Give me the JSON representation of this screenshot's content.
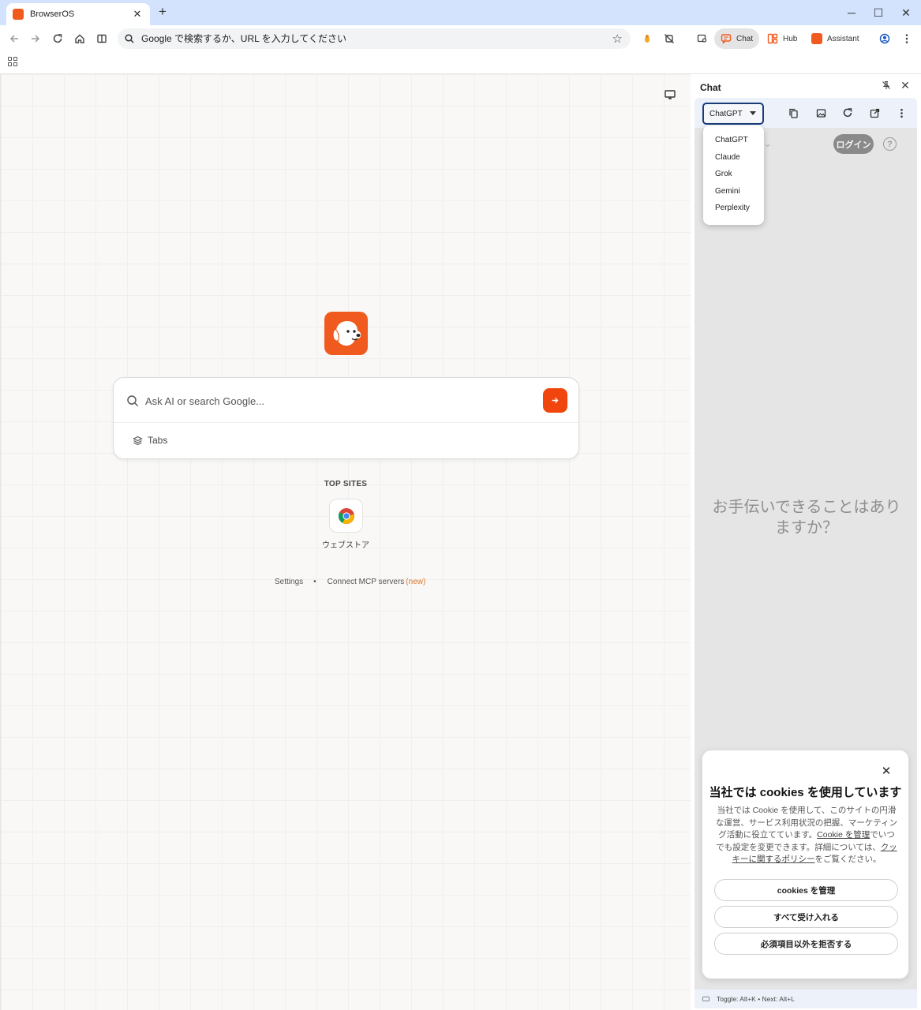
{
  "window": {
    "tab_title": "BrowserOS",
    "tab_close": "✕",
    "new_tab": "+",
    "minimize": "─",
    "maximize": "☐",
    "close": "✕"
  },
  "toolbar": {
    "omnibox_placeholder": "Google で検索するか、URL を入力してください",
    "chat_label": "Chat",
    "hub_label": "Hub",
    "assistant_label": "Assistant"
  },
  "main": {
    "search_placeholder": "Ask AI or search Google...",
    "tabs_label": "Tabs",
    "top_sites_label": "TOP SITES",
    "top_sites": [
      {
        "label": "ウェブストア"
      }
    ],
    "footer": {
      "settings": "Settings",
      "separator": "•",
      "connect_mcp": "Connect MCP servers",
      "new_badge": "(new)"
    }
  },
  "side_panel": {
    "title": "Chat",
    "provider_selected": "ChatGPT",
    "provider_options": [
      "ChatGPT",
      "Claude",
      "Grok",
      "Gemini",
      "Perplexity"
    ],
    "ghost_header": "T ⌄",
    "login_label": "ログイン",
    "help_label": "?",
    "greeting": "お手伝いできることはありますか？",
    "footer_shortcuts": "Toggle: Alt+K  •  Next: Alt+L"
  },
  "cookie_banner": {
    "title": "当社では cookies を使用しています",
    "body_part1": "当社では Cookie を使用して、このサイトの円滑な運営、サービス利用状況の把握、マーケティング活動に役立てています。",
    "manage_link": "Cookie を管理",
    "body_part2": "でいつでも設定を変更できます。詳細については、",
    "policy_link": "クッキーに関するポリシー",
    "body_part3": "をご覧ください。",
    "btn_manage": "cookies を管理",
    "btn_accept_all": "すべて受け入れる",
    "btn_reject": "必須項目以外を拒否する"
  },
  "colors": {
    "brand_orange": "#f05a1e",
    "titlebar": "#d3e3fd",
    "select_border": "#1a3d7a"
  }
}
